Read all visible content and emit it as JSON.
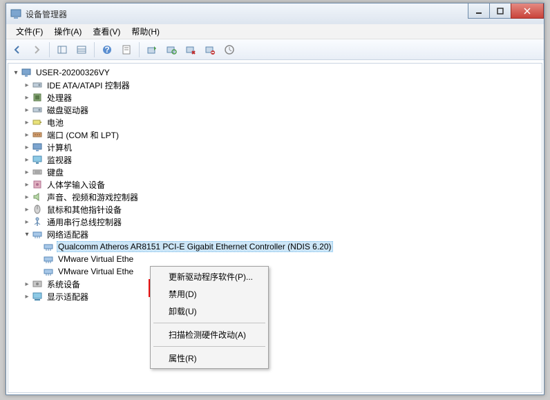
{
  "window": {
    "title": "设备管理器"
  },
  "menubar": {
    "file": "文件(F)",
    "action": "操作(A)",
    "view": "查看(V)",
    "help": "帮助(H)"
  },
  "toolbar_icons": [
    "back",
    "forward",
    "sep",
    "show-hide",
    "details",
    "sep",
    "help",
    "properties",
    "sep",
    "config",
    "refresh",
    "uninstall",
    "scan",
    "delete",
    "clock"
  ],
  "tree": {
    "root": "USER-20200326VY",
    "nodes": [
      {
        "label": "IDE ATA/ATAPI 控制器",
        "icon": "drive"
      },
      {
        "label": "处理器",
        "icon": "chip"
      },
      {
        "label": "磁盘驱动器",
        "icon": "drive"
      },
      {
        "label": "电池",
        "icon": "battery"
      },
      {
        "label": "端口 (COM 和 LPT)",
        "icon": "port"
      },
      {
        "label": "计算机",
        "icon": "computer"
      },
      {
        "label": "监视器",
        "icon": "monitor"
      },
      {
        "label": "键盘",
        "icon": "keyboard"
      },
      {
        "label": "人体学输入设备",
        "icon": "hid"
      },
      {
        "label": "声音、视频和游戏控制器",
        "icon": "audio"
      },
      {
        "label": "鼠标和其他指针设备",
        "icon": "mouse"
      },
      {
        "label": "通用串行总线控制器",
        "icon": "usb"
      },
      {
        "label": "网络适配器",
        "icon": "net",
        "expanded": true,
        "children": [
          {
            "label": "Qualcomm Atheros AR8151 PCI-E Gigabit Ethernet Controller (NDIS 6.20)",
            "icon": "net",
            "selected": true
          },
          {
            "label": "VMware Virtual Ethe",
            "icon": "net",
            "trunc": true
          },
          {
            "label": "VMware Virtual Ethe",
            "icon": "net",
            "trunc": true
          }
        ]
      },
      {
        "label": "系统设备",
        "icon": "sys"
      },
      {
        "label": "显示适配器",
        "icon": "display"
      }
    ]
  },
  "contextmenu": {
    "update_driver": "更新驱动程序软件(P)...",
    "disable": "禁用(D)",
    "uninstall": "卸载(U)",
    "scan_hw": "扫描检测硬件改动(A)",
    "properties": "属性(R)"
  }
}
